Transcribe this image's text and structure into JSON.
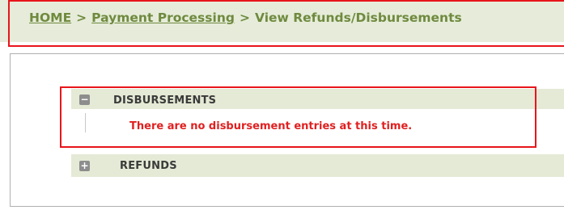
{
  "breadcrumb": {
    "home": "HOME",
    "separator": ">",
    "payment_processing": "Payment Processing",
    "current": "View Refunds/Disbursements"
  },
  "sections": {
    "disbursements": {
      "title": "DISBURSEMENTS",
      "toggle_icon": "collapse-icon",
      "toggle_glyph": "−",
      "message": "There are no disbursement entries at this time."
    },
    "refunds": {
      "title": "REFUNDS",
      "toggle_icon": "expand-icon",
      "toggle_glyph": "+"
    }
  },
  "colors": {
    "breadcrumb_text": "#6f8a3f",
    "header_background": "#e4ead5",
    "message_text": "#e02020",
    "highlight_border": "#e8151b"
  }
}
